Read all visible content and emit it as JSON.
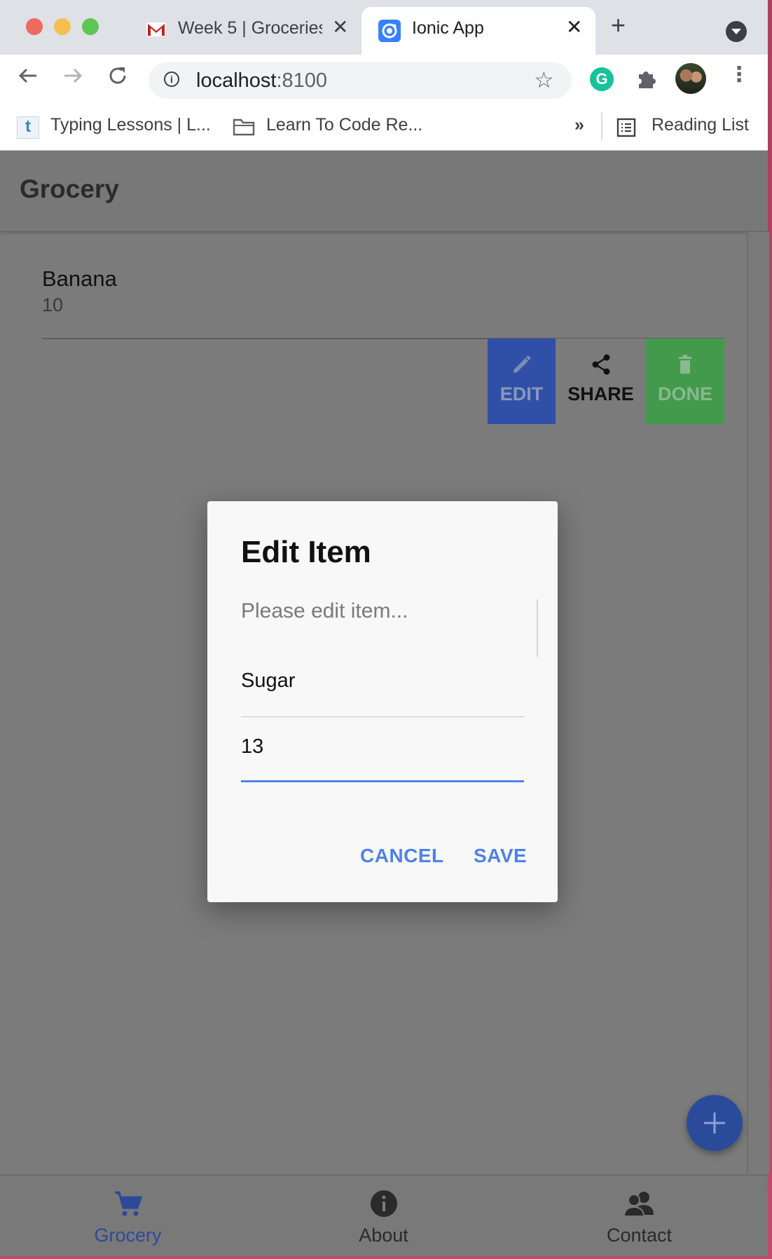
{
  "browser": {
    "tabs": [
      {
        "title": "Week 5 | Groceries",
        "active": false,
        "icon": "gmail-icon"
      },
      {
        "title": "Ionic App",
        "active": true,
        "icon": "ionic-icon"
      }
    ],
    "url_host": "localhost",
    "url_port": ":8100",
    "bookmarks": [
      {
        "label": "Typing Lessons | L...",
        "icon": "typing-site-icon"
      },
      {
        "label": "Learn To Code Re...",
        "icon": "folder-icon"
      }
    ],
    "bookmarks_overflow": "»",
    "reading_list": "Reading List",
    "grammarly_letter": "G"
  },
  "app": {
    "title": "Grocery",
    "items": [
      {
        "name": "Banana",
        "quantity": "10"
      }
    ],
    "item_options": {
      "edit": "EDIT",
      "share": "SHARE",
      "done": "DONE"
    },
    "colors": {
      "edit_bg": "#3050a8",
      "done_bg": "#449a4c",
      "primary": "#4e82e8"
    }
  },
  "dialog": {
    "title": "Edit Item",
    "message": "Please edit item...",
    "name_value": "Sugar",
    "quantity_value": "13",
    "cancel": "CANCEL",
    "save": "SAVE"
  },
  "tabbar": {
    "tabs": [
      {
        "label": "Grocery",
        "icon": "cart-icon",
        "selected": true
      },
      {
        "label": "About",
        "icon": "info-icon",
        "selected": false
      },
      {
        "label": "Contact",
        "icon": "people-icon",
        "selected": false
      }
    ]
  }
}
